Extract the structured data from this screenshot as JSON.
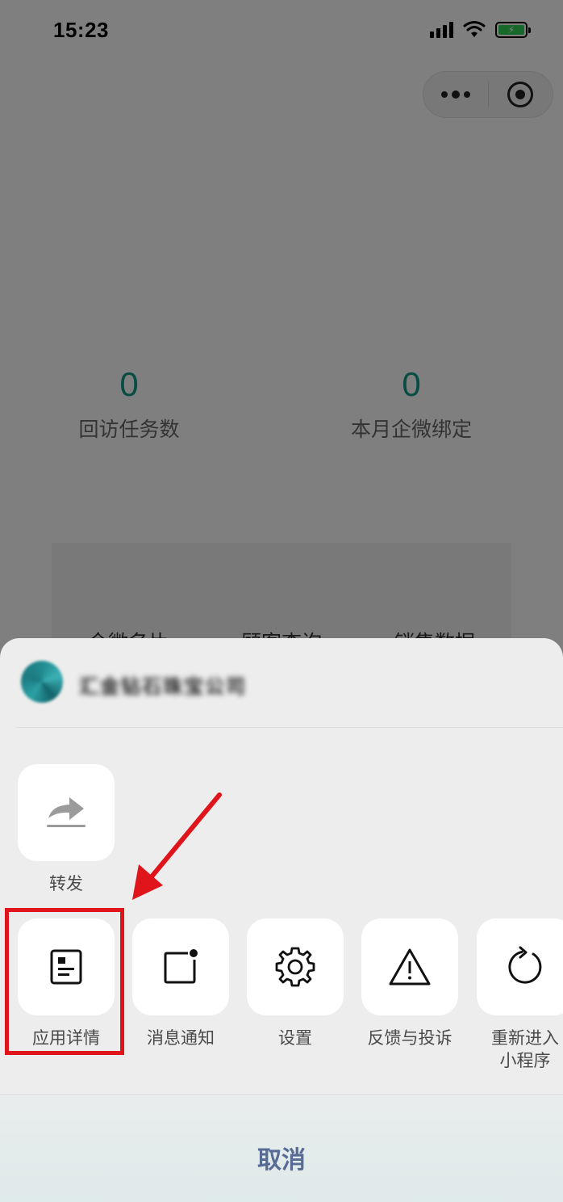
{
  "status_bar": {
    "time": "15:23",
    "battery_icon": "battery-charging-icon",
    "wifi_icon": "wifi-icon",
    "signal_icon": "cellular-signal-icon"
  },
  "capsule": {
    "more_icon": "more-dots-icon",
    "close_icon": "target-close-icon"
  },
  "stats": [
    {
      "value": "0",
      "label": "回访任务数"
    },
    {
      "value": "0",
      "label": "本月企微绑定"
    }
  ],
  "card": {
    "items": [
      "企微名片",
      "顾客查询",
      "销售数据"
    ]
  },
  "sheet": {
    "app_name": "汇金钻石珠宝公司",
    "share_row": [
      {
        "label": "转发",
        "icon": "forward-icon"
      }
    ],
    "actions": [
      {
        "label": "应用详情",
        "icon": "app-info-icon"
      },
      {
        "label": "消息通知",
        "icon": "notification-icon"
      },
      {
        "label": "设置",
        "icon": "gear-icon"
      },
      {
        "label": "反馈与投诉",
        "icon": "warning-icon"
      },
      {
        "label": "重新进入\n小程序",
        "icon": "reload-icon"
      }
    ],
    "cancel_label": "取消"
  },
  "colors": {
    "stat_value": "#0e9a86",
    "cancel_text": "#576b95",
    "annotation": "#e0151b"
  }
}
